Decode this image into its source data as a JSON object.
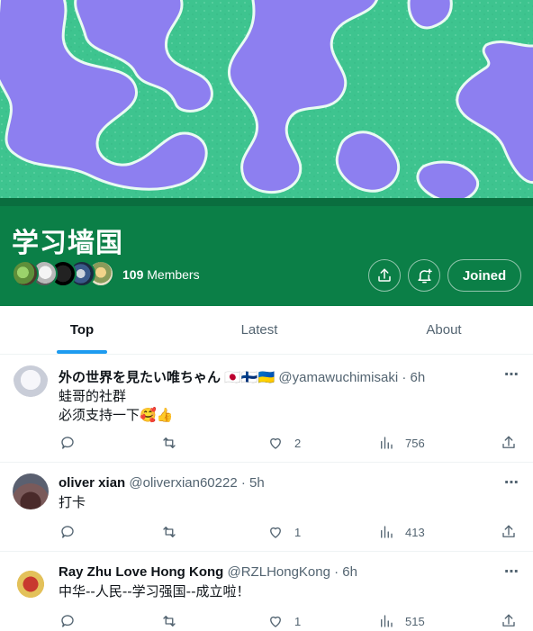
{
  "community": {
    "title": "学习墙国",
    "members_count": "109",
    "members_label": "Members",
    "joined_label": "Joined"
  },
  "tabs": [
    {
      "label": "Top",
      "active": true
    },
    {
      "label": "Latest",
      "active": false
    },
    {
      "label": "About",
      "active": false
    }
  ],
  "posts": [
    {
      "name": "外の世界を見たい唯ちゃん",
      "flags": "🇯🇵🇫🇮🇺🇦",
      "handle": "@yamawuchimisaki",
      "time": "· 6h",
      "lines": [
        "蛙哥的社群",
        "必须支持一下🥰👍"
      ],
      "likes": "2",
      "views": "756"
    },
    {
      "name": "oliver xian",
      "handle": "@oliverxian60222",
      "time": "· 5h",
      "lines": [
        "打卡"
      ],
      "likes": "1",
      "views": "413"
    },
    {
      "name": "Ray Zhu Love Hong Kong",
      "handle": "@RZLHongKong",
      "time": "· 6h",
      "lines": [
        "中华--人民--学习强国--成立啦！"
      ],
      "likes": "1",
      "views": "515"
    }
  ],
  "icons": {
    "more": "⋯",
    "share": "share-icon",
    "bell": "bell-plus-icon"
  },
  "colors": {
    "header_green": "#0b7f47",
    "accent_blue": "#1d9bf0",
    "banner_green": "#3ec48f",
    "banner_purple": "#8d7ff0"
  }
}
